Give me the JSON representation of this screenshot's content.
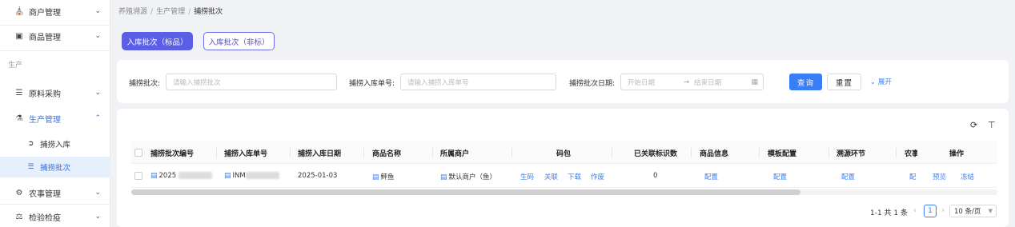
{
  "sidebar": {
    "merchant": "商户管理",
    "goods": "商品管理",
    "section_production": "生产",
    "raw_purchase": "原料采购",
    "production_mgmt": "生产管理",
    "catch_inbound": "捕捞入库",
    "catch_batch": "捕捞批次",
    "farming": "农事管理",
    "inspection": "检验检疫"
  },
  "breadcrumb": {
    "items": [
      "养殖溯源",
      "生产管理",
      "捕捞批次"
    ],
    "separator": "/"
  },
  "tabs": {
    "standard": "入库批次（标品）",
    "nonstandard": "入库批次（非标）"
  },
  "search": {
    "batch_label": "捕捞批次:",
    "batch_placeholder": "请输入捕捞批次",
    "inbound_label": "捕捞入库单号:",
    "inbound_placeholder": "请输入捕捞入库单号",
    "date_label": "捕捞批次日期:",
    "start_placeholder": "开始日期",
    "arrow": "→",
    "end_placeholder": "结束日期",
    "query_button": "查询",
    "reset_button": "重置",
    "expand_link": "展开"
  },
  "table": {
    "headers": {
      "batch_no": "捕捞批次编号",
      "inbound_no": "捕捞入库单号",
      "inbound_date": "捕捞入库日期",
      "goods_name": "商品名称",
      "merchant": "所属商户",
      "code_pack": "码包",
      "linked_count": "已关联标识数",
      "goods_info": "商品信息",
      "template": "模板配置",
      "trace_step": "溯源环节",
      "farming_cut": "农事",
      "actions": "操作"
    },
    "row": {
      "batch_no": "2025",
      "inbound_no": "INM",
      "inbound_date": "2025-01-03",
      "goods_name": "鲆鱼",
      "merchant": "默认商户（鱼）",
      "code_actions": [
        "生码",
        "关联",
        "下载",
        "作废"
      ],
      "linked_count": "0",
      "goods_info": "配置",
      "template": "配置",
      "trace_step": "配置",
      "farming_cut": "配",
      "action_preview": "预览",
      "action_freeze": "冻结"
    }
  },
  "pagination": {
    "total": "1-1 共 1 条",
    "current_page": "1",
    "page_size": "10 条/页"
  },
  "colors": {
    "primary": "#3a7ef6",
    "tab_primary": "#5b5ee6",
    "active_menu_bg": "#e6f0fc"
  }
}
